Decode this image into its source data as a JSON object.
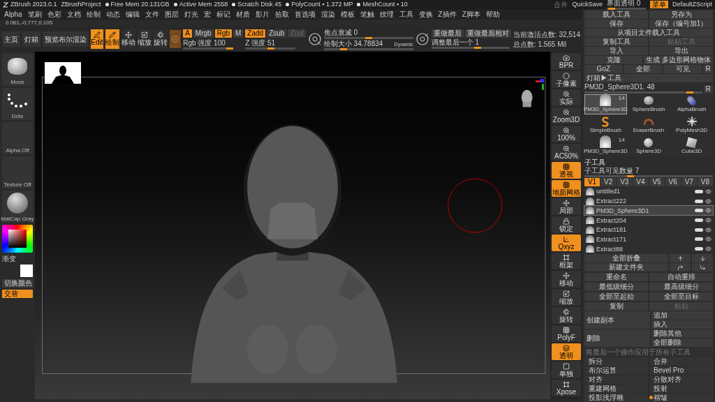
{
  "title_bar": {
    "items": [
      {
        "text": "ZBrush 2023.0.1",
        "kind": "app"
      },
      {
        "text": "ZBrushProject",
        "kind": "plain"
      },
      {
        "text": "Free Mem 20.131GB",
        "kind": "stat"
      },
      {
        "text": "Active Mem 2558",
        "kind": "stat"
      },
      {
        "text": "Scratch Disk 45",
        "kind": "stat"
      },
      {
        "text": "PolyCount ▪ 1.372 MP",
        "kind": "stat"
      },
      {
        "text": "MeshCount ▪ 10",
        "kind": "stat"
      }
    ],
    "merge": "合并",
    "quicksave": "QuickSave",
    "transparency": {
      "label": "界面透明 0",
      "level": 0.05
    },
    "menu_button": "菜单",
    "script": "DefaultZScript"
  },
  "menu_bar": [
    "Alpha",
    "笔刷",
    "色彩",
    "文档",
    "绘制",
    "动态",
    "编辑",
    "文件",
    "图层",
    "灯光",
    "宏",
    "标记",
    "材质",
    "影片",
    "拾取",
    "首选项",
    "渲染",
    "模板",
    "笔触",
    "纹理",
    "工具",
    "变换",
    "Z插件",
    "Z脚本",
    "帮助"
  ],
  "coordinates": "0.061,-0.777,0.105",
  "toolbar": {
    "nav_buttons": [
      "主页",
      "灯箱",
      "预览布尔渲染"
    ],
    "modes": [
      {
        "label": "Edit",
        "kind": "edit",
        "selected": true
      },
      {
        "label": "绘制",
        "kind": "draw",
        "selected": true
      },
      {
        "label": "移动",
        "kind": "move",
        "selected": false
      },
      {
        "label": "缩放",
        "kind": "scale",
        "selected": false
      },
      {
        "label": "旋转",
        "kind": "rotate",
        "selected": false
      }
    ],
    "channels": [
      {
        "label": "A",
        "on": true
      },
      {
        "label": "Mrgb",
        "on": false
      },
      {
        "label": "Rgb",
        "on": true
      },
      {
        "label": "M",
        "on": false
      }
    ],
    "rgb_intensity": {
      "label": "Rgb 强度 100",
      "level": 1
    },
    "z_modes": [
      {
        "label": "Zadd",
        "on": true,
        "disabled": false
      },
      {
        "label": "Zsub",
        "on": false,
        "disabled": false
      },
      {
        "label": "Zcut",
        "on": false,
        "disabled": true
      }
    ],
    "z_intensity": {
      "label": "Z 强度 51",
      "level": 0.51
    },
    "focal_shift": {
      "label": "焦点衰减 0",
      "level": 0.5
    },
    "draw_size": {
      "label": "绘制大小 34.78834",
      "level": 0.2,
      "badge": "Dynamic"
    },
    "redo_buttons": [
      "重做最后",
      "重做最后相对"
    ],
    "adjust_last": {
      "label": "调整最后一个 1",
      "level": 0.6
    },
    "stats": [
      "当前激活点数: 32,514",
      "总点数: 1.565 Mil"
    ]
  },
  "left_panel": {
    "tiles": [
      {
        "label": "Move",
        "kind": "brush"
      },
      {
        "label": "Dots",
        "kind": "stroke"
      },
      {
        "label": "Alpha Off",
        "kind": "empty"
      },
      {
        "label": "Texture Off",
        "kind": "empty"
      },
      {
        "label": "MatCap Gray",
        "kind": "material"
      }
    ],
    "gradient_label": "渐变",
    "swap_button": "切换颜色",
    "alternate": {
      "label": "交替",
      "on": true
    }
  },
  "shelf": [
    {
      "label": "BPR",
      "kind": "render",
      "on": false
    },
    {
      "label": "子像素",
      "kind": "subpixel",
      "on": false
    },
    {
      "label": "实际",
      "kind": "zoom",
      "on": false
    },
    {
      "label": "Zoom3D",
      "kind": "zoom",
      "on": false
    },
    {
      "label": "100%",
      "kind": "zoom",
      "on": false
    },
    {
      "label": "AC50%",
      "kind": "zoom",
      "on": false
    },
    {
      "label": "透视",
      "kind": "grid",
      "on": true
    },
    {
      "label": "地面网格",
      "kind": "grid",
      "on": true
    },
    {
      "label": "局部",
      "kind": "move",
      "on": false
    },
    {
      "label": "锁定",
      "kind": "lock",
      "on": false
    },
    {
      "label": "Qxyz",
      "kind": "axis",
      "on": true
    },
    {
      "label": "框架",
      "kind": "frame",
      "on": false
    },
    {
      "label": "移动",
      "kind": "move",
      "on": false
    },
    {
      "label": "缩放",
      "kind": "scale",
      "on": false
    },
    {
      "label": "旋转",
      "kind": "rotate",
      "on": false
    },
    {
      "label": "PolyF",
      "kind": "grid",
      "on": false
    },
    {
      "label": "透明",
      "kind": "layers",
      "on": true
    },
    {
      "label": "单独",
      "kind": "solo",
      "on": false
    },
    {
      "label": "Xpose",
      "kind": "frame",
      "on": false
    }
  ],
  "tool_panel": {
    "rows": [
      [
        {
          "label": "载入工具",
          "disabled": false
        },
        {
          "label": "另存为",
          "disabled": false
        }
      ],
      [
        {
          "label": "保存",
          "disabled": false
        },
        {
          "label": "保存（编号加1）",
          "disabled": false
        }
      ],
      [
        {
          "label": "从项目文件载入工具",
          "disabled": false
        }
      ],
      [
        {
          "label": "复制工具",
          "disabled": false
        },
        {
          "label": "粘贴工具",
          "disabled": true
        }
      ],
      [
        {
          "label": "导入",
          "disabled": false
        },
        {
          "label": "导出",
          "disabled": false
        }
      ],
      [
        {
          "label": "克隆",
          "disabled": false
        },
        {
          "label": "生成 多边形网格物体",
          "disabled": false
        }
      ],
      [
        {
          "label": "GoZ",
          "disabled": false
        },
        {
          "label": "全部",
          "disabled": false
        },
        {
          "label": "可见",
          "disabled": false
        },
        {
          "label": "R",
          "disabled": false
        }
      ]
    ],
    "lightbox": "灯箱▶工具",
    "current": {
      "label": "PM3D_Sphere3D1. 48",
      "level": 0.92
    },
    "current_r": "R",
    "tools": [
      {
        "name": "PM3D_Sphere3D",
        "kind": "mesh",
        "count": "14",
        "selected": true
      },
      {
        "name": "SphereBrush",
        "kind": "sphere_brush",
        "selected": false
      },
      {
        "name": "AlphaBrush",
        "kind": "alpha_brush",
        "selected": false
      },
      {
        "name": "SimpleBrush",
        "kind": "simple_brush",
        "selected": false
      },
      {
        "name": "EraserBrush",
        "kind": "eraser_brush",
        "selected": false
      },
      {
        "name": "PolyMesh3D",
        "kind": "star",
        "selected": false
      },
      {
        "name": "PM3D_Sphere3D",
        "kind": "mesh",
        "count": "14",
        "selected": false
      },
      {
        "name": "Sphere3D",
        "kind": "sphere",
        "selected": false
      },
      {
        "name": "Cube3D",
        "kind": "cube",
        "selected": false
      }
    ]
  },
  "subtool_panel": {
    "title": "子工具",
    "visible_count": {
      "label": "子工具可见数量 7",
      "level": 0.35
    },
    "versions": [
      {
        "label": "V1",
        "selected": true
      },
      {
        "label": "V2",
        "selected": false
      },
      {
        "label": "V3",
        "selected": false
      },
      {
        "label": "V4",
        "selected": false
      },
      {
        "label": "V5",
        "selected": false
      },
      {
        "label": "V6",
        "selected": false
      },
      {
        "label": "V7",
        "selected": false
      },
      {
        "label": "V8",
        "selected": false
      }
    ],
    "items": [
      {
        "name": "untitled1",
        "selected": false
      },
      {
        "name": "Extract222",
        "selected": false
      },
      {
        "name": "PM3D_Sphere3D1",
        "selected": true
      },
      {
        "name": "Extract204",
        "selected": false
      },
      {
        "name": "Extract181",
        "selected": false
      },
      {
        "name": "Extract171",
        "selected": false
      },
      {
        "name": "Extract88",
        "selected": false
      }
    ],
    "collapse_all": "全部折叠",
    "new_folder": "新建文件夹",
    "pairs": [
      [
        {
          "label": "重命名",
          "disabled": false
        },
        {
          "label": "自动重排",
          "disabled": false
        }
      ],
      [
        {
          "label": "最低级细分",
          "disabled": false
        },
        {
          "label": "最高级细分",
          "disabled": false
        }
      ],
      [
        {
          "label": "全部至起始",
          "disabled": false
        },
        {
          "label": "全部至目标",
          "disabled": false
        }
      ],
      [
        {
          "label": "复制",
          "disabled": false
        },
        {
          "label": "粘贴",
          "disabled": true
        }
      ]
    ],
    "duplicate": {
      "label": "创建副本",
      "options": [
        "追加",
        "插入"
      ]
    },
    "delete": {
      "label": "删除",
      "options": [
        "删除其他",
        "全部删除"
      ]
    },
    "note": "将最后一个操作应用于所有子工具"
  },
  "sections": [
    {
      "label": "拆分",
      "marked": false
    },
    {
      "label": "合并",
      "marked": false
    },
    {
      "label": "布尔运算",
      "marked": false
    },
    {
      "label": "Bevel Pro",
      "marked": false
    },
    {
      "label": "对齐",
      "marked": false
    },
    {
      "label": "分散对齐",
      "marked": false
    },
    {
      "label": "重建网格",
      "marked": false
    },
    {
      "label": "投射",
      "marked": false
    },
    {
      "label": "投影浅浮雕",
      "marked": false
    },
    {
      "label": "褶皱",
      "marked": true
    }
  ]
}
